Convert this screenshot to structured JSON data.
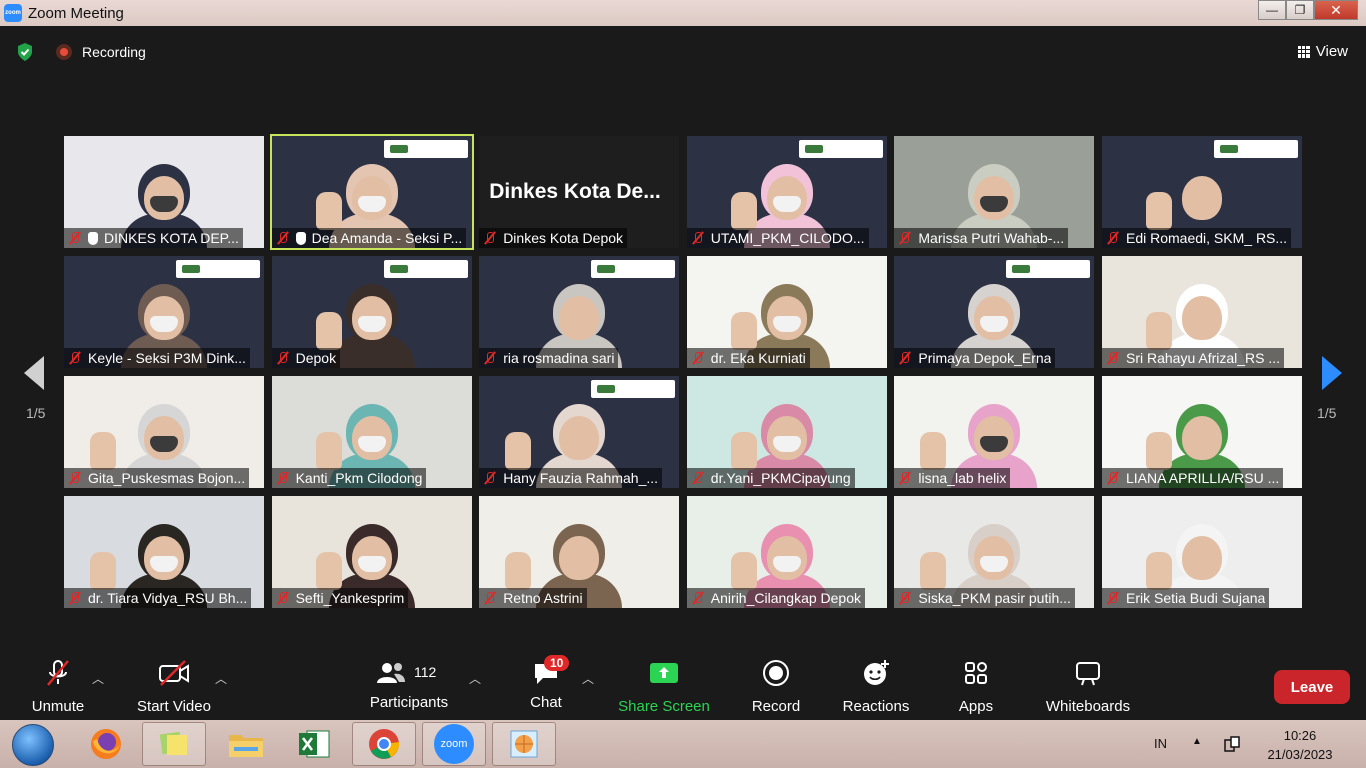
{
  "window": {
    "title": "Zoom Meeting",
    "minimize": "—",
    "maximize": "❐",
    "close": "✕"
  },
  "top": {
    "recording_label": "Recording",
    "view_label": "View"
  },
  "gallery": {
    "page_indicator_left": "1/5",
    "page_indicator_right": "1/5",
    "tiles": [
      {
        "name": "DINKES KOTA DEP...",
        "hand": true,
        "active": false
      },
      {
        "name": "Dea Amanda - Seksi P...",
        "hand": true,
        "active": true
      },
      {
        "name": "Dinkes Kota Depok",
        "hand": false,
        "active": false,
        "big_label": "Dinkes Kota De..."
      },
      {
        "name": "UTAMI_PKM_CILODO...",
        "hand": false,
        "active": false
      },
      {
        "name": "Marissa Putri Wahab-...",
        "hand": false,
        "active": false
      },
      {
        "name": "Edi Romaedi, SKM_ RS...",
        "hand": false,
        "active": false
      },
      {
        "name": "Keyle - Seksi P3M Dink...",
        "hand": false,
        "active": false
      },
      {
        "name": "Depok",
        "hand": false,
        "active": false
      },
      {
        "name": "ria rosmadina sari",
        "hand": false,
        "active": false
      },
      {
        "name": "dr. Eka Kurniati",
        "hand": false,
        "active": false
      },
      {
        "name": "Primaya Depok_Erna",
        "hand": false,
        "active": false
      },
      {
        "name": "Sri Rahayu Afrizal_RS ...",
        "hand": false,
        "active": false
      },
      {
        "name": "Gita_Puskesmas Bojon...",
        "hand": false,
        "active": false
      },
      {
        "name": "Kanti_Pkm Cilodong",
        "hand": false,
        "active": false
      },
      {
        "name": "Hany Fauzia Rahmah_...",
        "hand": false,
        "active": false
      },
      {
        "name": "dr.Yani_PKMCipayung",
        "hand": false,
        "active": false
      },
      {
        "name": "lisna_lab helix",
        "hand": false,
        "active": false
      },
      {
        "name": "LIANA APRILLIA/RSU ...",
        "hand": false,
        "active": false
      },
      {
        "name": "dr. Tiara Vidya_RSU Bh...",
        "hand": false,
        "active": false
      },
      {
        "name": "Sefti_Yankesprim",
        "hand": false,
        "active": false
      },
      {
        "name": "Retno Astrini",
        "hand": false,
        "active": false
      },
      {
        "name": "Anirih_Cilangkap Depok",
        "hand": false,
        "active": false
      },
      {
        "name": "Siska_PKM pasir putih...",
        "hand": false,
        "active": false
      },
      {
        "name": "Erik Setia Budi Sujana",
        "hand": false,
        "active": false
      }
    ]
  },
  "toolbar": {
    "unmute": "Unmute",
    "start_video": "Start Video",
    "participants": "Participants",
    "participants_count": "112",
    "chat": "Chat",
    "chat_badge": "10",
    "share_screen": "Share Screen",
    "record": "Record",
    "reactions": "Reactions",
    "apps": "Apps",
    "whiteboards": "Whiteboards",
    "leave": "Leave"
  },
  "taskbar": {
    "lang": "IN",
    "time": "10:26",
    "date": "21/03/2023",
    "zoom_label": "zoom"
  },
  "colors": {
    "accent": "#2d8cff",
    "share_green": "#2bd452",
    "leave_red": "#c9252a",
    "active_speaker": "#c6e35a",
    "muted_red": "#e02828"
  }
}
